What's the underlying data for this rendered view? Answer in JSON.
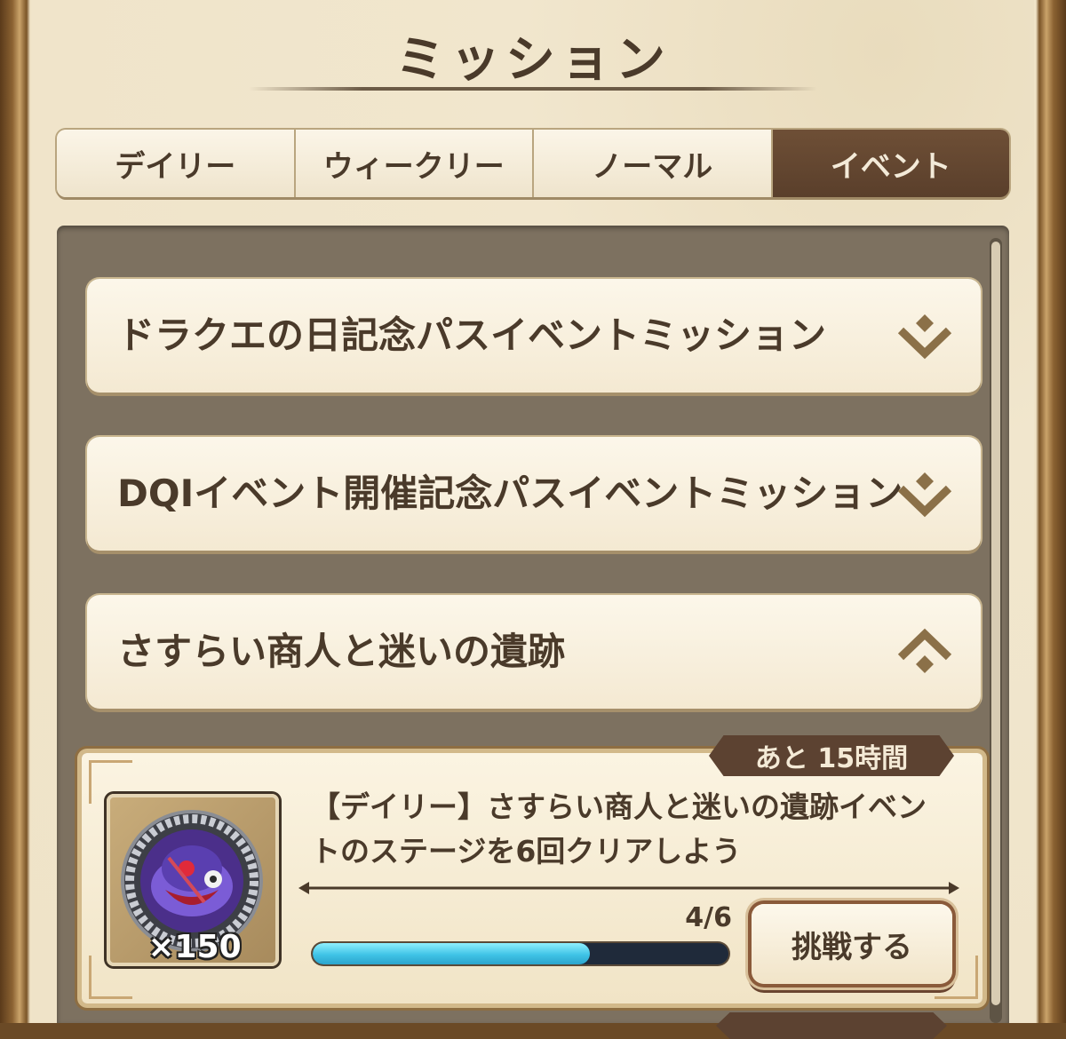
{
  "header": {
    "title": "ミッション"
  },
  "tabs": [
    {
      "label": "デイリー",
      "active": false
    },
    {
      "label": "ウィークリー",
      "active": false
    },
    {
      "label": "ノーマル",
      "active": false
    },
    {
      "label": "イベント",
      "active": true
    }
  ],
  "categories": [
    {
      "label": "ドラクエの日記念パスイベントミッション",
      "expanded": false,
      "icon": "chevron-down-icon"
    },
    {
      "label": "DQⅠイベント開催記念パスイベントミッション",
      "expanded": false,
      "icon": "chevron-down-icon"
    },
    {
      "label": "さすらい商人と迷いの遺跡",
      "expanded": true,
      "icon": "chevron-up-icon"
    }
  ],
  "mission": {
    "time_remaining": "あと 15時間",
    "description": "【デイリー】さすらい商人と迷いの遺跡イベントのステージを6回クリアしよう",
    "reward": {
      "icon": "medal-icon",
      "quantity": "×150"
    },
    "progress_text": "4/6",
    "progress": {
      "current": 4,
      "total": 6
    },
    "action_label": "挑戦する"
  },
  "colors": {
    "panel_bg": "#efe3c8",
    "tab_active": "#5a3f2b",
    "text_dark": "#4a3a2a",
    "progress_fill": "#3fc3e6",
    "chevron": "#8b7048"
  }
}
